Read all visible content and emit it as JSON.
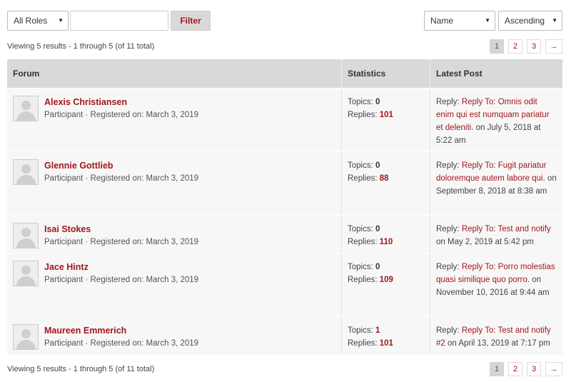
{
  "filters": {
    "role_select": "All Roles",
    "search_value": "",
    "filter_button": "Filter",
    "sort_select": "Name",
    "order_select": "Ascending"
  },
  "viewing_text": "Viewing 5 results - 1 through 5 (of 11 total)",
  "pagination": {
    "pages": [
      "1",
      "2",
      "3"
    ],
    "current": "1",
    "next": "→"
  },
  "table": {
    "headers": {
      "forum": "Forum",
      "statistics": "Statistics",
      "latest": "Latest Post"
    },
    "topics_label": "Topics:",
    "replies_label": "Replies:",
    "reply_prefix": "Reply:",
    "rows": [
      {
        "name": "Alexis Christiansen",
        "meta": "Participant · Registered on: March 3, 2019",
        "topics": "0",
        "replies": "101",
        "latest_link": "Reply To: Omnis odit enim qui est numquam pariatur et deleniti.",
        "latest_date": " on July 5, 2018 at 5:22 am"
      },
      {
        "name": "Glennie Gottlieb",
        "meta": "Participant · Registered on: March 3, 2019",
        "topics": "0",
        "replies": "88",
        "latest_link": "Reply To: Fugit pariatur doloremque autem labore qui.",
        "latest_date": " on September 8, 2018 at 8:38 am"
      },
      {
        "name": "Isai Stokes",
        "meta": "Participant · Registered on: March 3, 2019",
        "topics": "0",
        "replies": "110",
        "latest_link": "Reply To: Test and notify",
        "latest_date": " on May 2, 2019 at 5:42 pm"
      },
      {
        "name": "Jace Hintz",
        "meta": "Participant · Registered on: March 3, 2019",
        "topics": "0",
        "replies": "109",
        "latest_link": "Reply To: Porro molestias quasi similique quo porro.",
        "latest_date": " on November 10, 2016 at 9:44 am"
      },
      {
        "name": "Maureen Emmerich",
        "meta": "Participant · Registered on: March 3, 2019",
        "topics": "1",
        "replies": "101",
        "latest_link": "Reply To: Test and notify #2",
        "latest_date": " on April 13, 2019 at 7:17 pm"
      }
    ]
  }
}
